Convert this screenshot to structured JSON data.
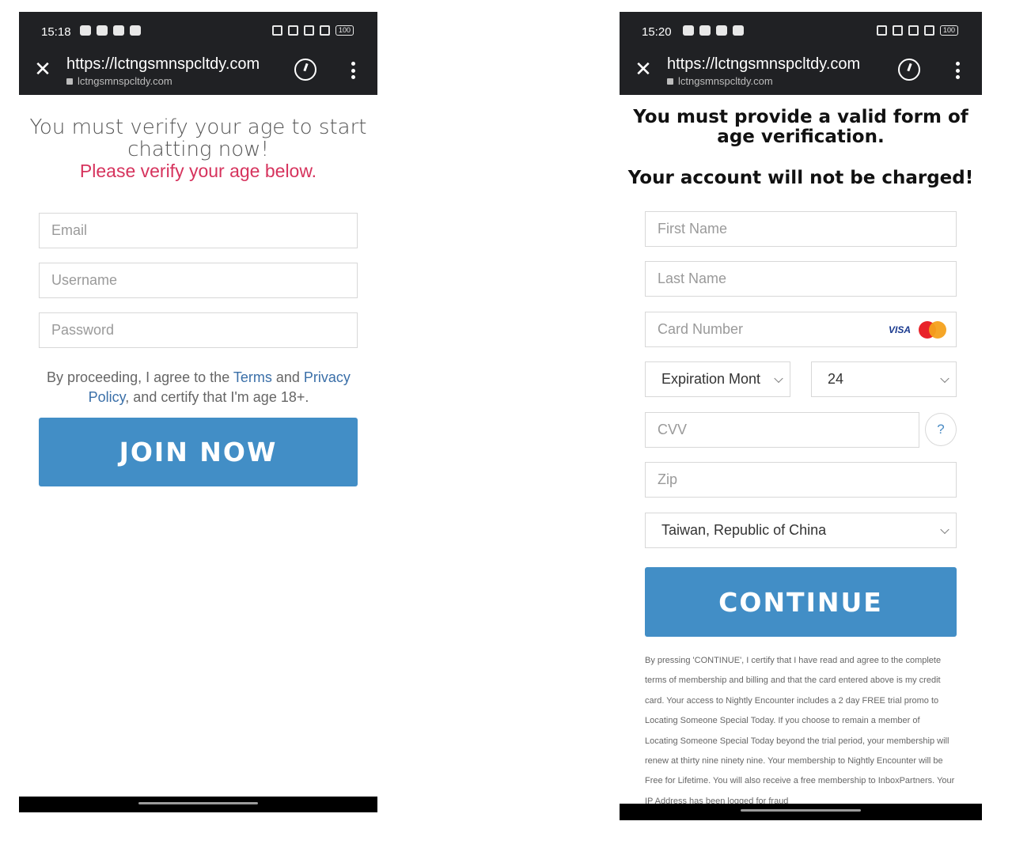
{
  "left": {
    "status": {
      "time": "15:18",
      "battery": "100"
    },
    "browser": {
      "url": "https://lctngsmnspcltdy.com",
      "domain": "lctngsmnspcltdy.com"
    },
    "page": {
      "title": "You must verify your age to start chatting now!",
      "subtitle": "Please verify your age below.",
      "email_placeholder": "Email",
      "username_placeholder": "Username",
      "password_placeholder": "Password",
      "terms_prefix": "By proceeding, I agree to the ",
      "terms_link": "Terms",
      "terms_and": " and ",
      "privacy_link": "Privacy Policy",
      "terms_suffix": ", and certify that I'm age 18+.",
      "join_button": "JOIN NOW"
    }
  },
  "right": {
    "status": {
      "time": "15:20",
      "battery": "100"
    },
    "browser": {
      "url": "https://lctngsmnspcltdy.com",
      "domain": "lctngsmnspcltdy.com"
    },
    "page": {
      "heading": "You must provide a valid form of age verification.",
      "subheading": "Your account will not be charged!",
      "first_name_placeholder": "First Name",
      "last_name_placeholder": "Last Name",
      "card_number_placeholder": "Card Number",
      "visa_label": "VISA",
      "expiration_month": "Expiration Mont",
      "expiration_year": "24",
      "cvv_placeholder": "CVV",
      "cvv_help": "?",
      "zip_placeholder": "Zip",
      "country": "Taiwan, Republic of China",
      "continue_button": "CONTINUE",
      "legal_text": "By pressing 'CONTINUE', I certify that I have read and agree to the complete terms of membership and billing and that the card entered above is my credit card. Your access to Nightly Encounter includes a 2 day FREE trial promo to Locating Someone Special Today. If you choose to remain a member of Locating Someone Special Today beyond the trial period, your membership will renew at thirty nine ninety nine. Your membership to Nightly Encounter will be Free for Lifetime. You will also receive a free membership to InboxPartners. Your IP Address has been logged for fraud"
    }
  }
}
